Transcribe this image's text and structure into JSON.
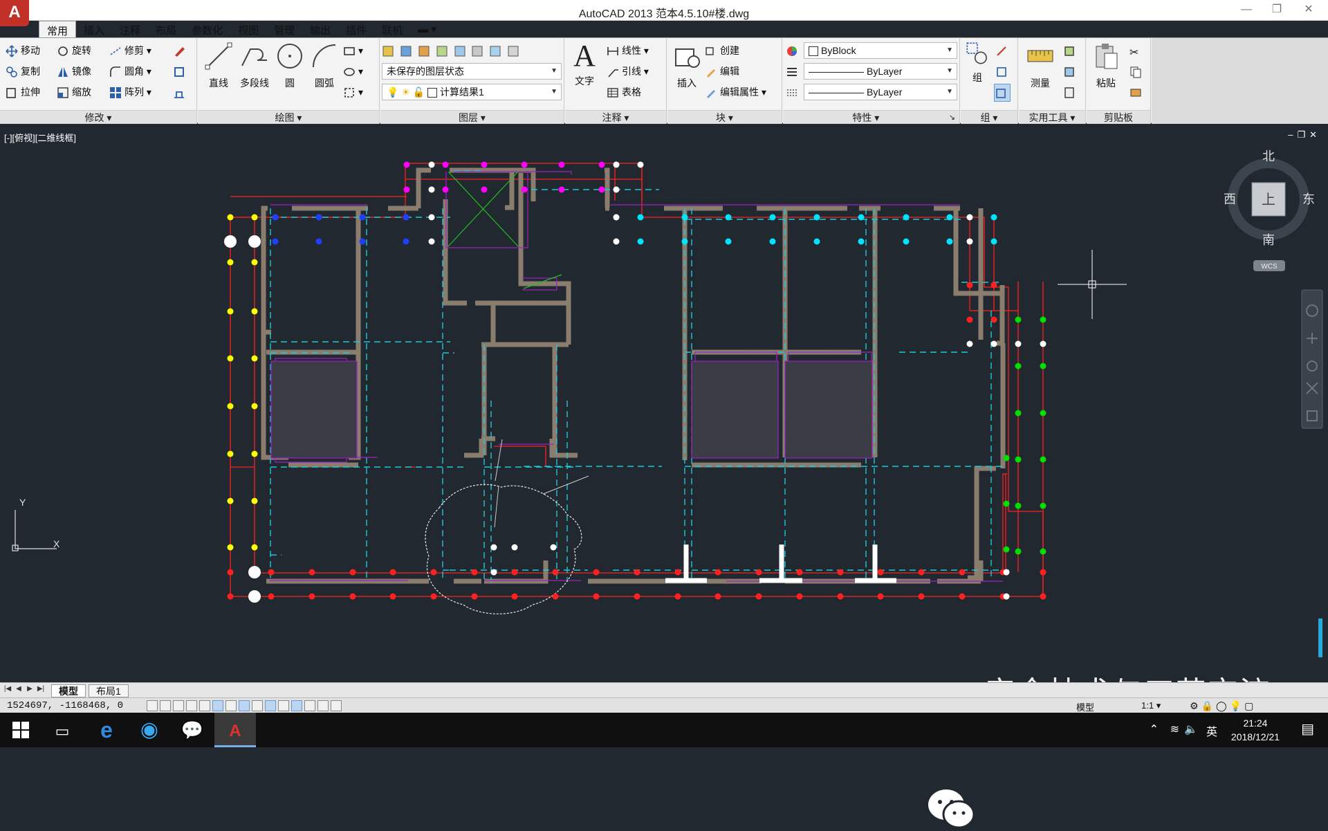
{
  "title_bar": {
    "title": "AutoCAD 2013    范本4.5.10#楼.dwg",
    "app_button": "A"
  },
  "ribbon_tabs": [
    "常用",
    "插入",
    "注释",
    "布局",
    "参数化",
    "视图",
    "管理",
    "输出",
    "插件",
    "联机"
  ],
  "ribbon": {
    "modify": {
      "title": "修改",
      "items": [
        "移动",
        "旋转",
        "修剪",
        "复制",
        "镜像",
        "圆角",
        "拉伸",
        "缩放",
        "阵列"
      ]
    },
    "draw": {
      "title": "绘图",
      "items": [
        "直线",
        "多段线",
        "圆",
        "圆弧"
      ]
    },
    "layer": {
      "title": "图层",
      "state": "未保存的图层状态",
      "current": "计算结果1"
    },
    "annotation": {
      "title": "注释",
      "text": "文字",
      "items": [
        "线性",
        "引线",
        "表格"
      ]
    },
    "block": {
      "title": "块",
      "insert": "插入",
      "items": [
        "创建",
        "编辑",
        "编辑属性"
      ]
    },
    "properties": {
      "title": "特性",
      "color": "ByBlock",
      "linetype": "ByLayer",
      "lineweight": "ByLayer"
    },
    "group": {
      "title": "组",
      "label": "组"
    },
    "utilities": {
      "title": "实用工具",
      "label": "测量"
    },
    "clipboard": {
      "title": "剪贴板",
      "label": "粘贴"
    }
  },
  "viewport": {
    "label": "[-][俯视][二维线框]",
    "viewcube": {
      "north": "北",
      "south": "南",
      "east": "东",
      "west": "西",
      "top": "上",
      "wcs": "WCS"
    },
    "ucs": {
      "x": "X",
      "y": "Y"
    }
  },
  "layout_tabs": [
    "模型",
    "布局1"
  ],
  "status": {
    "coordinates": "1524697,  -1168468,  0",
    "model_label": "模型",
    "scale": "1:1"
  },
  "watermark": "安全技术与工艺交流",
  "taskbar": {
    "time": "21:24",
    "date": "2018/12/21",
    "ime": "英"
  },
  "colors": {
    "canvas": "#212830",
    "wall": "#8a7d6e",
    "grid_red": "#ff2020",
    "dot_yellow": "#ffff00",
    "dot_magenta": "#ff00ff",
    "dot_cyan": "#00e5ff",
    "dot_green": "#00e000",
    "dash_cyan": "#1ec8d8",
    "purple": "#a020c0"
  }
}
